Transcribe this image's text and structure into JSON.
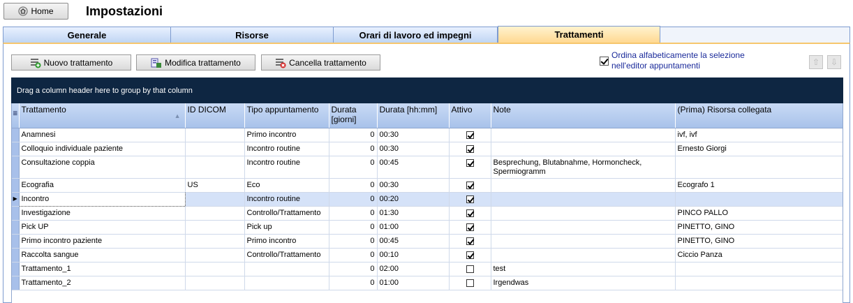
{
  "header": {
    "home_label": "Home",
    "page_title": "Impostazioni"
  },
  "tabs": [
    {
      "label": "Generale",
      "active": false
    },
    {
      "label": "Risorse",
      "active": false
    },
    {
      "label": "Orari di lavoro ed impegni",
      "active": false
    },
    {
      "label": "Trattamenti",
      "active": true
    }
  ],
  "toolbar": {
    "new_label": "Nuovo trattamento",
    "edit_label": "Modifica trattamento",
    "delete_label": "Cancella trattamento",
    "sort_checkbox_label": "Ordina alfabeticamente la selezione nell'editor appuntamenti",
    "sort_checked": true,
    "move_up_icon": "arrow-up-icon",
    "move_down_icon": "arrow-down-icon"
  },
  "grid": {
    "group_panel_text": "Drag a column header here to group by that column",
    "columns": [
      "Trattamento",
      "ID DICOM",
      "Tipo appuntamento",
      "Durata [giorni]",
      "Durata [hh:mm]",
      "Attivo",
      "Note",
      "(Prima) Risorsa collegata"
    ],
    "rows": [
      {
        "name": "Anamnesi",
        "dicom": "",
        "type": "Primo incontro",
        "days": "0",
        "duration": "00:30",
        "active": true,
        "note": "",
        "resource": "ivf, ivf"
      },
      {
        "name": "Colloquio individuale paziente",
        "dicom": "",
        "type": "Incontro routine",
        "days": "0",
        "duration": "00:30",
        "active": true,
        "note": "",
        "resource": "Ernesto Giorgi"
      },
      {
        "name": "Consultazione coppia",
        "dicom": "",
        "type": "Incontro routine",
        "days": "0",
        "duration": "00:45",
        "active": true,
        "note": "Besprechung, Blutabnahme, Hormoncheck, Spermiogramm",
        "resource": ""
      },
      {
        "name": "Ecografia",
        "dicom": "US",
        "type": "Eco",
        "days": "0",
        "duration": "00:30",
        "active": true,
        "note": "",
        "resource": "Ecografo 1"
      },
      {
        "name": "Incontro",
        "dicom": "",
        "type": "Incontro routine",
        "days": "0",
        "duration": "00:20",
        "active": true,
        "note": "",
        "resource": "",
        "current": true
      },
      {
        "name": "Investigazione",
        "dicom": "",
        "type": "Controllo/Trattamento",
        "days": "0",
        "duration": "01:30",
        "active": true,
        "note": "",
        "resource": "PINCO PALLO"
      },
      {
        "name": "Pick UP",
        "dicom": "",
        "type": "Pick up",
        "days": "0",
        "duration": "01:00",
        "active": true,
        "note": "",
        "resource": "PINETTO, GINO"
      },
      {
        "name": "Primo incontro paziente",
        "dicom": "",
        "type": "Primo incontro",
        "days": "0",
        "duration": "00:45",
        "active": true,
        "note": "",
        "resource": "PINETTO, GINO"
      },
      {
        "name": "Raccolta sangue",
        "dicom": "",
        "type": "Controllo/Trattamento",
        "days": "0",
        "duration": "00:10",
        "active": true,
        "note": "",
        "resource": "Ciccio Panza"
      },
      {
        "name": "Trattamento_1",
        "dicom": "",
        "type": "",
        "days": "0",
        "duration": "02:00",
        "active": false,
        "note": "test",
        "resource": ""
      },
      {
        "name": "Trattamento_2",
        "dicom": "",
        "type": "",
        "days": "0",
        "duration": "01:00",
        "active": false,
        "note": "Irgendwas",
        "resource": ""
      }
    ]
  },
  "colors": {
    "accent_active_tab": "#ffd68c",
    "group_panel_bg": "#0e2642",
    "header_bg": "#bcd3f2"
  }
}
